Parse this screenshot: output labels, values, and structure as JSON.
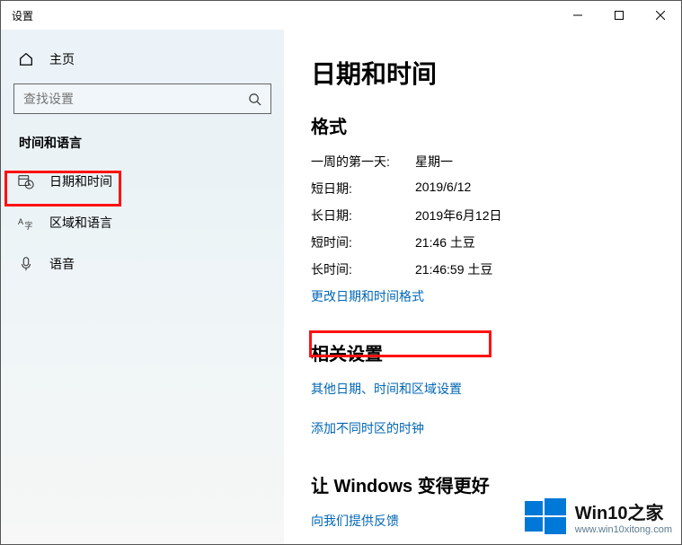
{
  "window": {
    "title": "设置"
  },
  "sidebar": {
    "home": "主页",
    "search_placeholder": "查找设置",
    "section": "时间和语言",
    "items": [
      {
        "label": "日期和时间"
      },
      {
        "label": "区域和语言"
      },
      {
        "label": "语音"
      }
    ]
  },
  "main": {
    "title": "日期和时间",
    "format_heading": "格式",
    "rows": [
      {
        "k": "一周的第一天:",
        "v": "星期一"
      },
      {
        "k": "短日期:",
        "v": "2019/6/12"
      },
      {
        "k": "长日期:",
        "v": "2019年6月12日"
      },
      {
        "k": "短时间:",
        "v": "21:46 土豆"
      },
      {
        "k": "长时间:",
        "v": "21:46:59 土豆"
      }
    ],
    "change_format_link": "更改日期和时间格式",
    "related_heading": "相关设置",
    "related_link1": "其他日期、时间和区域设置",
    "related_link2": "添加不同时区的时钟",
    "better_heading": "让 Windows 变得更好",
    "feedback_link": "向我们提供反馈"
  },
  "watermark": {
    "title": "Win10之家",
    "url": "www.win10xitong.com"
  }
}
